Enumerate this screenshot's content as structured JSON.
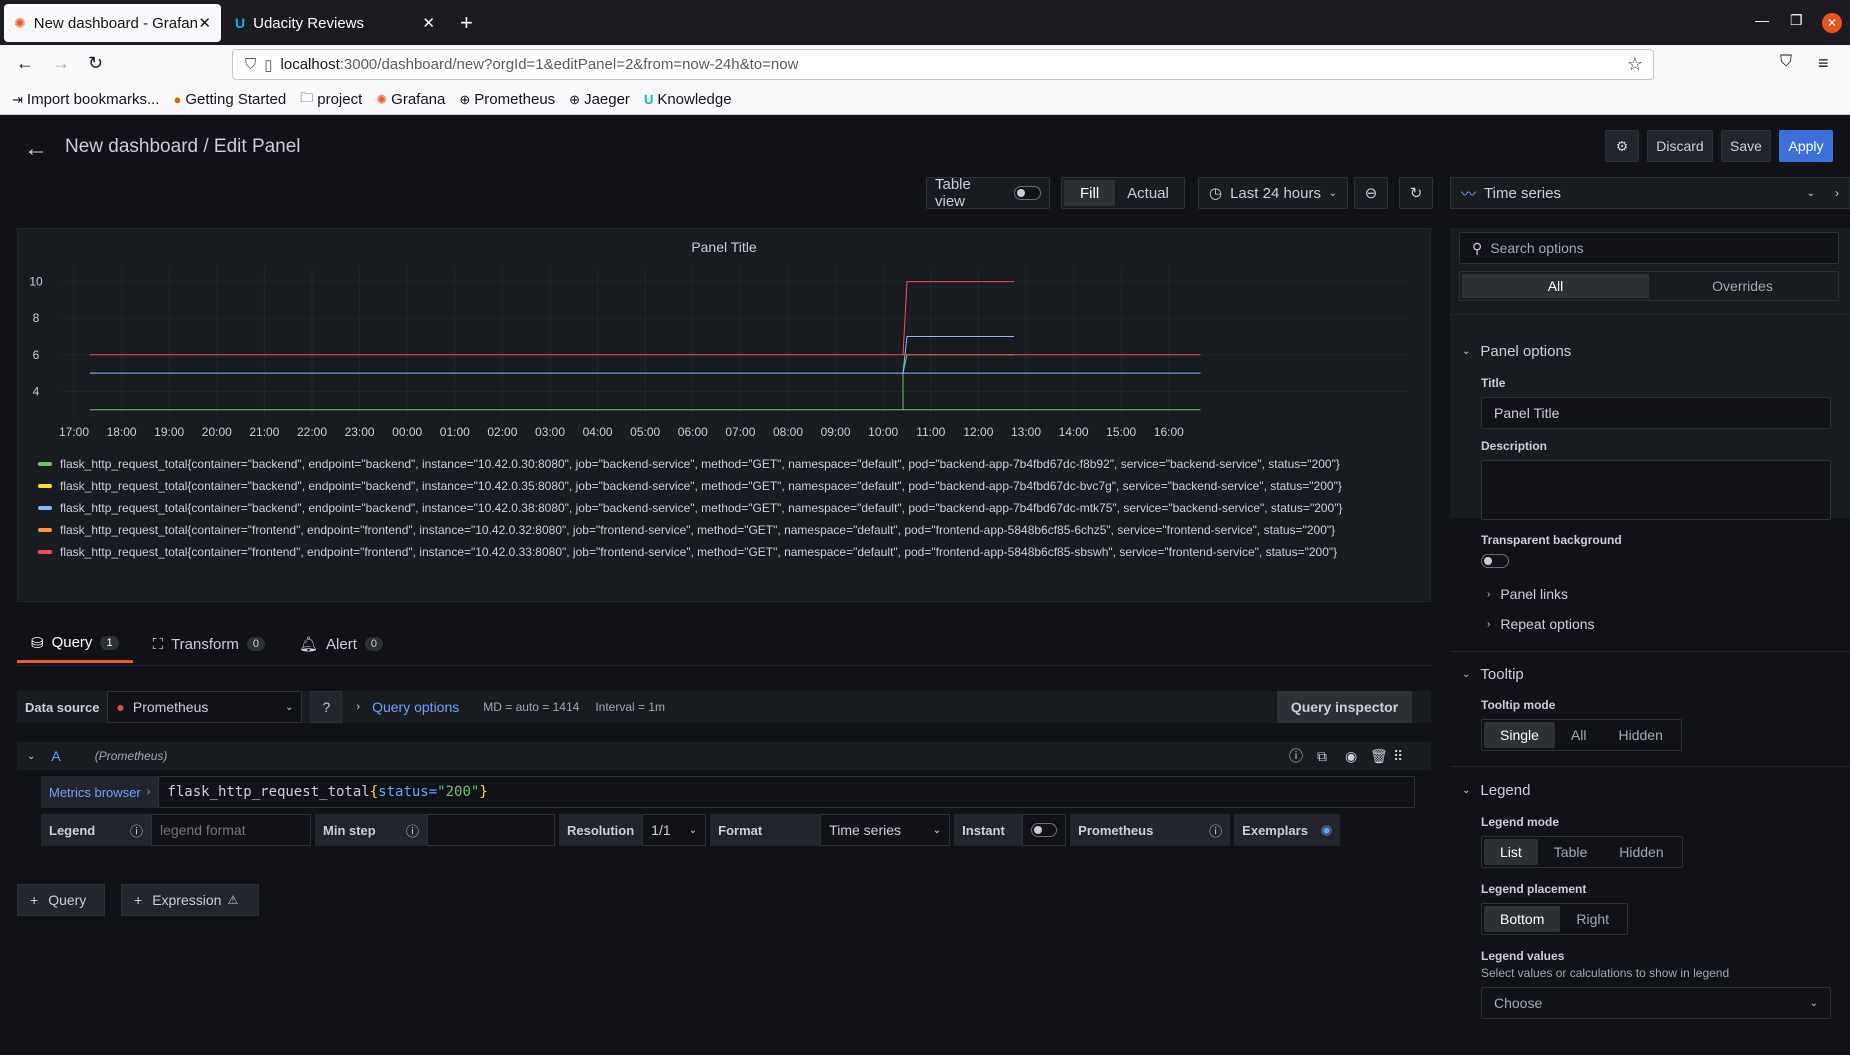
{
  "browser": {
    "tabs": [
      {
        "label": "New dashboard - Grafana",
        "icon": "grafana-icon"
      },
      {
        "label": "Udacity Reviews",
        "icon": "udacity-icon"
      }
    ],
    "url_host": "localhost",
    "url_rest": ":3000/dashboard/new?orgId=1&editPanel=2&from=now-24h&to=now",
    "bookmarks": [
      {
        "label": "Import bookmarks...",
        "icon": "import-icon"
      },
      {
        "label": "Getting Started",
        "icon": "firefox-icon"
      },
      {
        "label": "project",
        "icon": "folder-icon"
      },
      {
        "label": "Grafana",
        "icon": "grafana-icon"
      },
      {
        "label": "Prometheus",
        "icon": "globe-icon"
      },
      {
        "label": "Jaeger",
        "icon": "globe-icon"
      },
      {
        "label": "Knowledge",
        "icon": "udacity-icon"
      }
    ]
  },
  "header": {
    "title": "New dashboard / Edit Panel",
    "discard_label": "Discard",
    "save_label": "Save",
    "apply_label": "Apply"
  },
  "toolbar": {
    "table_view_label": "Table view",
    "fill_label": "Fill",
    "actual_label": "Actual",
    "time_range": "Last 24 hours",
    "viz_type": "Time series"
  },
  "panel": {
    "title": "Panel Title"
  },
  "chart_data": {
    "type": "line",
    "x_ticks": [
      "17:00",
      "18:00",
      "19:00",
      "20:00",
      "21:00",
      "22:00",
      "23:00",
      "00:00",
      "01:00",
      "02:00",
      "03:00",
      "04:00",
      "05:00",
      "06:00",
      "07:00",
      "08:00",
      "09:00",
      "10:00",
      "11:00",
      "12:00",
      "13:00",
      "14:00",
      "15:00",
      "16:00"
    ],
    "y_ticks": [
      4,
      6,
      8,
      10
    ],
    "ylim": [
      2.6,
      10.8
    ],
    "series": [
      {
        "name": "flask_http_request_total{container=\"backend\", endpoint=\"backend\", instance=\"10.42.0.30:8080\", job=\"backend-service\", method=\"GET\", namespace=\"default\", pod=\"backend-app-7b4fbd67dc-f8b92\", service=\"backend-service\", status=\"200\"}",
        "color": "#73bf69",
        "segments": [
          {
            "x": [
              "16:40",
              "17:20"
            ],
            "y": [
              3,
              3
            ]
          },
          {
            "x": [
              "10:25",
              "10:25",
              "10:30",
              "12:45"
            ],
            "y": [
              3,
              5,
              6,
              6
            ]
          }
        ]
      },
      {
        "name": "flask_http_request_total{container=\"backend\", endpoint=\"backend\", instance=\"10.42.0.35:8080\", job=\"backend-service\", method=\"GET\", namespace=\"default\", pod=\"backend-app-7b4fbd67dc-bvc7g\", service=\"backend-service\", status=\"200\"}",
        "color": "#fade2a",
        "segments": []
      },
      {
        "name": "flask_http_request_total{container=\"backend\", endpoint=\"backend\", instance=\"10.42.0.38:8080\", job=\"backend-service\", method=\"GET\", namespace=\"default\", pod=\"backend-app-7b4fbd67dc-mtk75\", service=\"backend-service\", status=\"200\"}",
        "color": "#8ab8ff",
        "segments": [
          {
            "x": [
              "16:40",
              "17:20"
            ],
            "y": [
              5,
              5
            ]
          },
          {
            "x": [
              "10:25",
              "10:30",
              "12:45"
            ],
            "y": [
              5,
              7,
              7
            ]
          }
        ]
      },
      {
        "name": "flask_http_request_total{container=\"frontend\", endpoint=\"frontend\", instance=\"10.42.0.32:8080\", job=\"frontend-service\", method=\"GET\", namespace=\"default\", pod=\"frontend-app-5848b6cf85-6chz5\", service=\"frontend-service\", status=\"200\"}",
        "color": "#ff9830",
        "segments": []
      },
      {
        "name": "flask_http_request_total{container=\"frontend\", endpoint=\"frontend\", instance=\"10.42.0.33:8080\", job=\"frontend-service\", method=\"GET\", namespace=\"default\", pod=\"frontend-app-5848b6cf85-sbswh\", service=\"frontend-service\", status=\"200\"}",
        "color": "#f2495c",
        "segments": [
          {
            "x": [
              "16:40",
              "17:20"
            ],
            "y": [
              6,
              6
            ]
          },
          {
            "x": [
              "10:25",
              "10:30",
              "12:45"
            ],
            "y": [
              6,
              10,
              10
            ]
          }
        ]
      }
    ]
  },
  "query_tabs": [
    {
      "label": "Query",
      "count": "1"
    },
    {
      "label": "Transform",
      "count": "0"
    },
    {
      "label": "Alert",
      "count": "0"
    }
  ],
  "query": {
    "datasource_label": "Data source",
    "datasource": "Prometheus",
    "query_options_label": "Query options",
    "md": "MD = auto = 1414",
    "interval": "Interval = 1m",
    "inspector_label": "Query inspector",
    "ref_id": "A",
    "ref_ds": "(Prometheus)",
    "metrics_browser": "Metrics browser",
    "expr_metric": "flask_http_request_total",
    "expr_open": "{",
    "expr_key": "status=",
    "expr_value": "\"200\"",
    "expr_close": "}",
    "legend_label": "Legend",
    "legend_placeholder": "legend format",
    "min_step_label": "Min step",
    "resolution_label": "Resolution",
    "resolution_value": "1/1",
    "format_label": "Format",
    "format_value": "Time series",
    "instant_label": "Instant",
    "prometheus_label": "Prometheus",
    "exemplars_label": "Exemplars",
    "add_query_label": "Query",
    "add_expression_label": "Expression"
  },
  "options": {
    "search_placeholder": "Search options",
    "tab_all": "All",
    "tab_overrides": "Overrides",
    "panel_options_title": "Panel options",
    "title_label": "Title",
    "title_value": "Panel Title",
    "description_label": "Description",
    "transparent_label": "Transparent background",
    "panel_links": "Panel links",
    "repeat_options": "Repeat options",
    "tooltip_title": "Tooltip",
    "tooltip_mode_label": "Tooltip mode",
    "tooltip_modes": [
      "Single",
      "All",
      "Hidden"
    ],
    "legend_title": "Legend",
    "legend_mode_label": "Legend mode",
    "legend_modes": [
      "List",
      "Table",
      "Hidden"
    ],
    "legend_placement_label": "Legend placement",
    "legend_placements": [
      "Bottom",
      "Right"
    ],
    "legend_values_label": "Legend values",
    "legend_values_desc": "Select values or calculations to show in legend",
    "legend_values_placeholder": "Choose"
  }
}
